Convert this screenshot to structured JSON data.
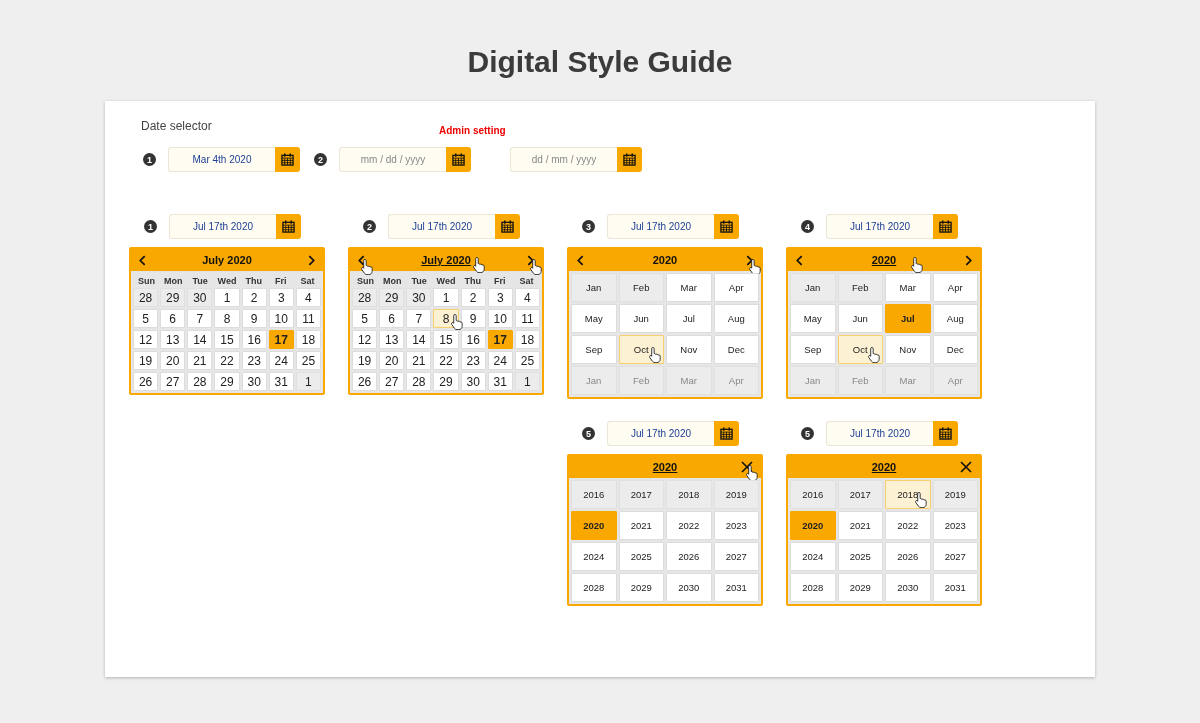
{
  "title": "Digital Style Guide",
  "section": {
    "label": "Date selector",
    "admin_note": "Admin setting",
    "fields": [
      {
        "badge": "1",
        "value": "Mar 4th 2020"
      },
      {
        "badge": "2",
        "placeholder": "mm / dd / yyyy"
      },
      {
        "placeholder": "dd / mm / yyyy"
      }
    ]
  },
  "widgets": [
    {
      "field": {
        "badge": "1",
        "value": "Jul 17th 2020"
      },
      "panel": {
        "kind": "days",
        "title": "July 2020",
        "title_underlined": false,
        "title_hovered": false,
        "controls": [
          {
            "kind": "prev",
            "hovered": false
          },
          {
            "kind": "next",
            "hovered": false
          }
        ],
        "weekdays": [
          "Sun",
          "Mon",
          "Tue",
          "Wed",
          "Thu",
          "Fri",
          "Sat"
        ],
        "cells": [
          {
            "label": "28",
            "kind": "other",
            "selected": false,
            "hovered": false
          },
          {
            "label": "29",
            "kind": "other",
            "selected": false,
            "hovered": false
          },
          {
            "label": "30",
            "kind": "other",
            "selected": false,
            "hovered": false
          },
          {
            "label": "1",
            "kind": "current",
            "selected": false,
            "hovered": false
          },
          {
            "label": "2",
            "kind": "current",
            "selected": false,
            "hovered": false
          },
          {
            "label": "3",
            "kind": "current",
            "selected": false,
            "hovered": false
          },
          {
            "label": "4",
            "kind": "current",
            "selected": false,
            "hovered": false
          },
          {
            "label": "5",
            "kind": "current",
            "selected": false,
            "hovered": false
          },
          {
            "label": "6",
            "kind": "current",
            "selected": false,
            "hovered": false
          },
          {
            "label": "7",
            "kind": "current",
            "selected": false,
            "hovered": false
          },
          {
            "label": "8",
            "kind": "current",
            "selected": false,
            "hovered": false
          },
          {
            "label": "9",
            "kind": "current",
            "selected": false,
            "hovered": false
          },
          {
            "label": "10",
            "kind": "current",
            "selected": false,
            "hovered": false
          },
          {
            "label": "11",
            "kind": "current",
            "selected": false,
            "hovered": false
          },
          {
            "label": "12",
            "kind": "current",
            "selected": false,
            "hovered": false
          },
          {
            "label": "13",
            "kind": "current",
            "selected": false,
            "hovered": false
          },
          {
            "label": "14",
            "kind": "current",
            "selected": false,
            "hovered": false
          },
          {
            "label": "15",
            "kind": "current",
            "selected": false,
            "hovered": false
          },
          {
            "label": "16",
            "kind": "current",
            "selected": false,
            "hovered": false
          },
          {
            "label": "17",
            "kind": "current",
            "selected": true,
            "hovered": false
          },
          {
            "label": "18",
            "kind": "current",
            "selected": false,
            "hovered": false
          },
          {
            "label": "19",
            "kind": "current",
            "selected": false,
            "hovered": false
          },
          {
            "label": "20",
            "kind": "current",
            "selected": false,
            "hovered": false
          },
          {
            "label": "21",
            "kind": "current",
            "selected": false,
            "hovered": false
          },
          {
            "label": "22",
            "kind": "current",
            "selected": false,
            "hovered": false
          },
          {
            "label": "23",
            "kind": "current",
            "selected": false,
            "hovered": false
          },
          {
            "label": "24",
            "kind": "current",
            "selected": false,
            "hovered": false
          },
          {
            "label": "25",
            "kind": "current",
            "selected": false,
            "hovered": false
          },
          {
            "label": "26",
            "kind": "current",
            "selected": false,
            "hovered": false
          },
          {
            "label": "27",
            "kind": "current",
            "selected": false,
            "hovered": false
          },
          {
            "label": "28",
            "kind": "current",
            "selected": false,
            "hovered": false
          },
          {
            "label": "29",
            "kind": "current",
            "selected": false,
            "hovered": false
          },
          {
            "label": "30",
            "kind": "current",
            "selected": false,
            "hovered": false
          },
          {
            "label": "31",
            "kind": "current",
            "selected": false,
            "hovered": false
          },
          {
            "label": "1",
            "kind": "other",
            "selected": false,
            "hovered": false
          }
        ]
      }
    },
    {
      "field": {
        "badge": "2",
        "value": "Jul 17th 2020"
      },
      "panel": {
        "kind": "days",
        "title": "July 2020",
        "title_underlined": true,
        "title_hovered": true,
        "controls": [
          {
            "kind": "prev",
            "hovered": true
          },
          {
            "kind": "next",
            "hovered": true
          }
        ],
        "weekdays": [
          "Sun",
          "Mon",
          "Tue",
          "Wed",
          "Thu",
          "Fri",
          "Sat"
        ],
        "cells": [
          {
            "label": "28",
            "kind": "other",
            "selected": false,
            "hovered": false
          },
          {
            "label": "29",
            "kind": "other",
            "selected": false,
            "hovered": false
          },
          {
            "label": "30",
            "kind": "other",
            "selected": false,
            "hovered": false
          },
          {
            "label": "1",
            "kind": "current",
            "selected": false,
            "hovered": false
          },
          {
            "label": "2",
            "kind": "current",
            "selected": false,
            "hovered": false
          },
          {
            "label": "3",
            "kind": "current",
            "selected": false,
            "hovered": false
          },
          {
            "label": "4",
            "kind": "current",
            "selected": false,
            "hovered": false
          },
          {
            "label": "5",
            "kind": "current",
            "selected": false,
            "hovered": false
          },
          {
            "label": "6",
            "kind": "current",
            "selected": false,
            "hovered": false
          },
          {
            "label": "7",
            "kind": "current",
            "selected": false,
            "hovered": false
          },
          {
            "label": "8",
            "kind": "current",
            "selected": false,
            "hovered": true
          },
          {
            "label": "9",
            "kind": "current",
            "selected": false,
            "hovered": false
          },
          {
            "label": "10",
            "kind": "current",
            "selected": false,
            "hovered": false
          },
          {
            "label": "11",
            "kind": "current",
            "selected": false,
            "hovered": false
          },
          {
            "label": "12",
            "kind": "current",
            "selected": false,
            "hovered": false
          },
          {
            "label": "13",
            "kind": "current",
            "selected": false,
            "hovered": false
          },
          {
            "label": "14",
            "kind": "current",
            "selected": false,
            "hovered": false
          },
          {
            "label": "15",
            "kind": "current",
            "selected": false,
            "hovered": false
          },
          {
            "label": "16",
            "kind": "current",
            "selected": false,
            "hovered": false
          },
          {
            "label": "17",
            "kind": "current",
            "selected": true,
            "hovered": false
          },
          {
            "label": "18",
            "kind": "current",
            "selected": false,
            "hovered": false
          },
          {
            "label": "19",
            "kind": "current",
            "selected": false,
            "hovered": false
          },
          {
            "label": "20",
            "kind": "current",
            "selected": false,
            "hovered": false
          },
          {
            "label": "21",
            "kind": "current",
            "selected": false,
            "hovered": false
          },
          {
            "label": "22",
            "kind": "current",
            "selected": false,
            "hovered": false
          },
          {
            "label": "23",
            "kind": "current",
            "selected": false,
            "hovered": false
          },
          {
            "label": "24",
            "kind": "current",
            "selected": false,
            "hovered": false
          },
          {
            "label": "25",
            "kind": "current",
            "selected": false,
            "hovered": false
          },
          {
            "label": "26",
            "kind": "current",
            "selected": false,
            "hovered": false
          },
          {
            "label": "27",
            "kind": "current",
            "selected": false,
            "hovered": false
          },
          {
            "label": "28",
            "kind": "current",
            "selected": false,
            "hovered": false
          },
          {
            "label": "29",
            "kind": "current",
            "selected": false,
            "hovered": false
          },
          {
            "label": "30",
            "kind": "current",
            "selected": false,
            "hovered": false
          },
          {
            "label": "31",
            "kind": "current",
            "selected": false,
            "hovered": false
          },
          {
            "label": "1",
            "kind": "other",
            "selected": false,
            "hovered": false
          }
        ]
      }
    },
    {
      "field": {
        "badge": "3",
        "value": "Jul 17th 2020"
      },
      "panel": {
        "kind": "months",
        "title": "2020",
        "title_underlined": false,
        "title_hovered": false,
        "controls": [
          {
            "kind": "prev",
            "hovered": false
          },
          {
            "kind": "next",
            "hovered": true
          }
        ],
        "cells": [
          {
            "label": "Jan",
            "kind": "other",
            "selected": false,
            "hovered": false
          },
          {
            "label": "Feb",
            "kind": "other",
            "selected": false,
            "hovered": false
          },
          {
            "label": "Mar",
            "kind": "current",
            "selected": false,
            "hovered": false
          },
          {
            "label": "Apr",
            "kind": "current",
            "selected": false,
            "hovered": false
          },
          {
            "label": "May",
            "kind": "current",
            "selected": false,
            "hovered": false
          },
          {
            "label": "Jun",
            "kind": "current",
            "selected": false,
            "hovered": false
          },
          {
            "label": "Jul",
            "kind": "current",
            "selected": false,
            "hovered": false
          },
          {
            "label": "Aug",
            "kind": "current",
            "selected": false,
            "hovered": false
          },
          {
            "label": "Sep",
            "kind": "current",
            "selected": false,
            "hovered": false
          },
          {
            "label": "Oct",
            "kind": "current",
            "selected": false,
            "hovered": true
          },
          {
            "label": "Nov",
            "kind": "current",
            "selected": false,
            "hovered": false
          },
          {
            "label": "Dec",
            "kind": "current",
            "selected": false,
            "hovered": false
          },
          {
            "label": "Jan",
            "kind": "next",
            "selected": false,
            "hovered": false
          },
          {
            "label": "Feb",
            "kind": "next",
            "selected": false,
            "hovered": false
          },
          {
            "label": "Mar",
            "kind": "next",
            "selected": false,
            "hovered": false
          },
          {
            "label": "Apr",
            "kind": "next",
            "selected": false,
            "hovered": false
          }
        ]
      }
    },
    {
      "field": {
        "badge": "4",
        "value": "Jul 17th 2020"
      },
      "panel": {
        "kind": "months",
        "title": "2020",
        "title_underlined": true,
        "title_hovered": true,
        "controls": [
          {
            "kind": "prev",
            "hovered": false
          },
          {
            "kind": "next",
            "hovered": false
          }
        ],
        "cells": [
          {
            "label": "Jan",
            "kind": "other",
            "selected": false,
            "hovered": false
          },
          {
            "label": "Feb",
            "kind": "other",
            "selected": false,
            "hovered": false
          },
          {
            "label": "Mar",
            "kind": "current",
            "selected": false,
            "hovered": false
          },
          {
            "label": "Apr",
            "kind": "current",
            "selected": false,
            "hovered": false
          },
          {
            "label": "May",
            "kind": "current",
            "selected": false,
            "hovered": false
          },
          {
            "label": "Jun",
            "kind": "current",
            "selected": false,
            "hovered": false
          },
          {
            "label": "Jul",
            "kind": "current",
            "selected": true,
            "hovered": false
          },
          {
            "label": "Aug",
            "kind": "current",
            "selected": false,
            "hovered": false
          },
          {
            "label": "Sep",
            "kind": "current",
            "selected": false,
            "hovered": false
          },
          {
            "label": "Oct",
            "kind": "current",
            "selected": false,
            "hovered": true
          },
          {
            "label": "Nov",
            "kind": "current",
            "selected": false,
            "hovered": false
          },
          {
            "label": "Dec",
            "kind": "current",
            "selected": false,
            "hovered": false
          },
          {
            "label": "Jan",
            "kind": "next",
            "selected": false,
            "hovered": false
          },
          {
            "label": "Feb",
            "kind": "next",
            "selected": false,
            "hovered": false
          },
          {
            "label": "Mar",
            "kind": "next",
            "selected": false,
            "hovered": false
          },
          {
            "label": "Apr",
            "kind": "next",
            "selected": false,
            "hovered": false
          }
        ]
      }
    },
    {
      "field": {
        "badge": "5",
        "value": "Jul 17th 2020"
      },
      "panel": {
        "kind": "years",
        "title": "2020",
        "title_underlined": true,
        "title_hovered": false,
        "controls": [
          {
            "kind": "close",
            "hovered": true
          }
        ],
        "cells": [
          {
            "label": "2016",
            "kind": "other",
            "selected": false,
            "hovered": false
          },
          {
            "label": "2017",
            "kind": "other",
            "selected": false,
            "hovered": false
          },
          {
            "label": "2018",
            "kind": "other",
            "selected": false,
            "hovered": false
          },
          {
            "label": "2019",
            "kind": "other",
            "selected": false,
            "hovered": false
          },
          {
            "label": "2020",
            "kind": "current",
            "selected": true,
            "hovered": false
          },
          {
            "label": "2021",
            "kind": "current",
            "selected": false,
            "hovered": false
          },
          {
            "label": "2022",
            "kind": "current",
            "selected": false,
            "hovered": false
          },
          {
            "label": "2023",
            "kind": "current",
            "selected": false,
            "hovered": false
          },
          {
            "label": "2024",
            "kind": "current",
            "selected": false,
            "hovered": false
          },
          {
            "label": "2025",
            "kind": "current",
            "selected": false,
            "hovered": false
          },
          {
            "label": "2026",
            "kind": "current",
            "selected": false,
            "hovered": false
          },
          {
            "label": "2027",
            "kind": "current",
            "selected": false,
            "hovered": false
          },
          {
            "label": "2028",
            "kind": "current",
            "selected": false,
            "hovered": false
          },
          {
            "label": "2029",
            "kind": "current",
            "selected": false,
            "hovered": false
          },
          {
            "label": "2030",
            "kind": "current",
            "selected": false,
            "hovered": false
          },
          {
            "label": "2031",
            "kind": "current",
            "selected": false,
            "hovered": false
          }
        ]
      }
    },
    {
      "field": {
        "badge": "5",
        "value": "Jul 17th 2020"
      },
      "panel": {
        "kind": "years",
        "title": "2020",
        "title_underlined": true,
        "title_hovered": false,
        "controls": [
          {
            "kind": "close",
            "hovered": false
          }
        ],
        "cells": [
          {
            "label": "2016",
            "kind": "other",
            "selected": false,
            "hovered": false
          },
          {
            "label": "2017",
            "kind": "other",
            "selected": false,
            "hovered": false
          },
          {
            "label": "2018",
            "kind": "other",
            "selected": false,
            "hovered": true
          },
          {
            "label": "2019",
            "kind": "other",
            "selected": false,
            "hovered": false
          },
          {
            "label": "2020",
            "kind": "current",
            "selected": true,
            "hovered": false
          },
          {
            "label": "2021",
            "kind": "current",
            "selected": false,
            "hovered": false
          },
          {
            "label": "2022",
            "kind": "current",
            "selected": false,
            "hovered": false
          },
          {
            "label": "2023",
            "kind": "current",
            "selected": false,
            "hovered": false
          },
          {
            "label": "2024",
            "kind": "current",
            "selected": false,
            "hovered": false
          },
          {
            "label": "2025",
            "kind": "current",
            "selected": false,
            "hovered": false
          },
          {
            "label": "2026",
            "kind": "current",
            "selected": false,
            "hovered": false
          },
          {
            "label": "2027",
            "kind": "current",
            "selected": false,
            "hovered": false
          },
          {
            "label": "2028",
            "kind": "current",
            "selected": false,
            "hovered": false
          },
          {
            "label": "2029",
            "kind": "current",
            "selected": false,
            "hovered": false
          },
          {
            "label": "2030",
            "kind": "current",
            "selected": false,
            "hovered": false
          },
          {
            "label": "2031",
            "kind": "current",
            "selected": false,
            "hovered": false
          }
        ]
      }
    }
  ]
}
